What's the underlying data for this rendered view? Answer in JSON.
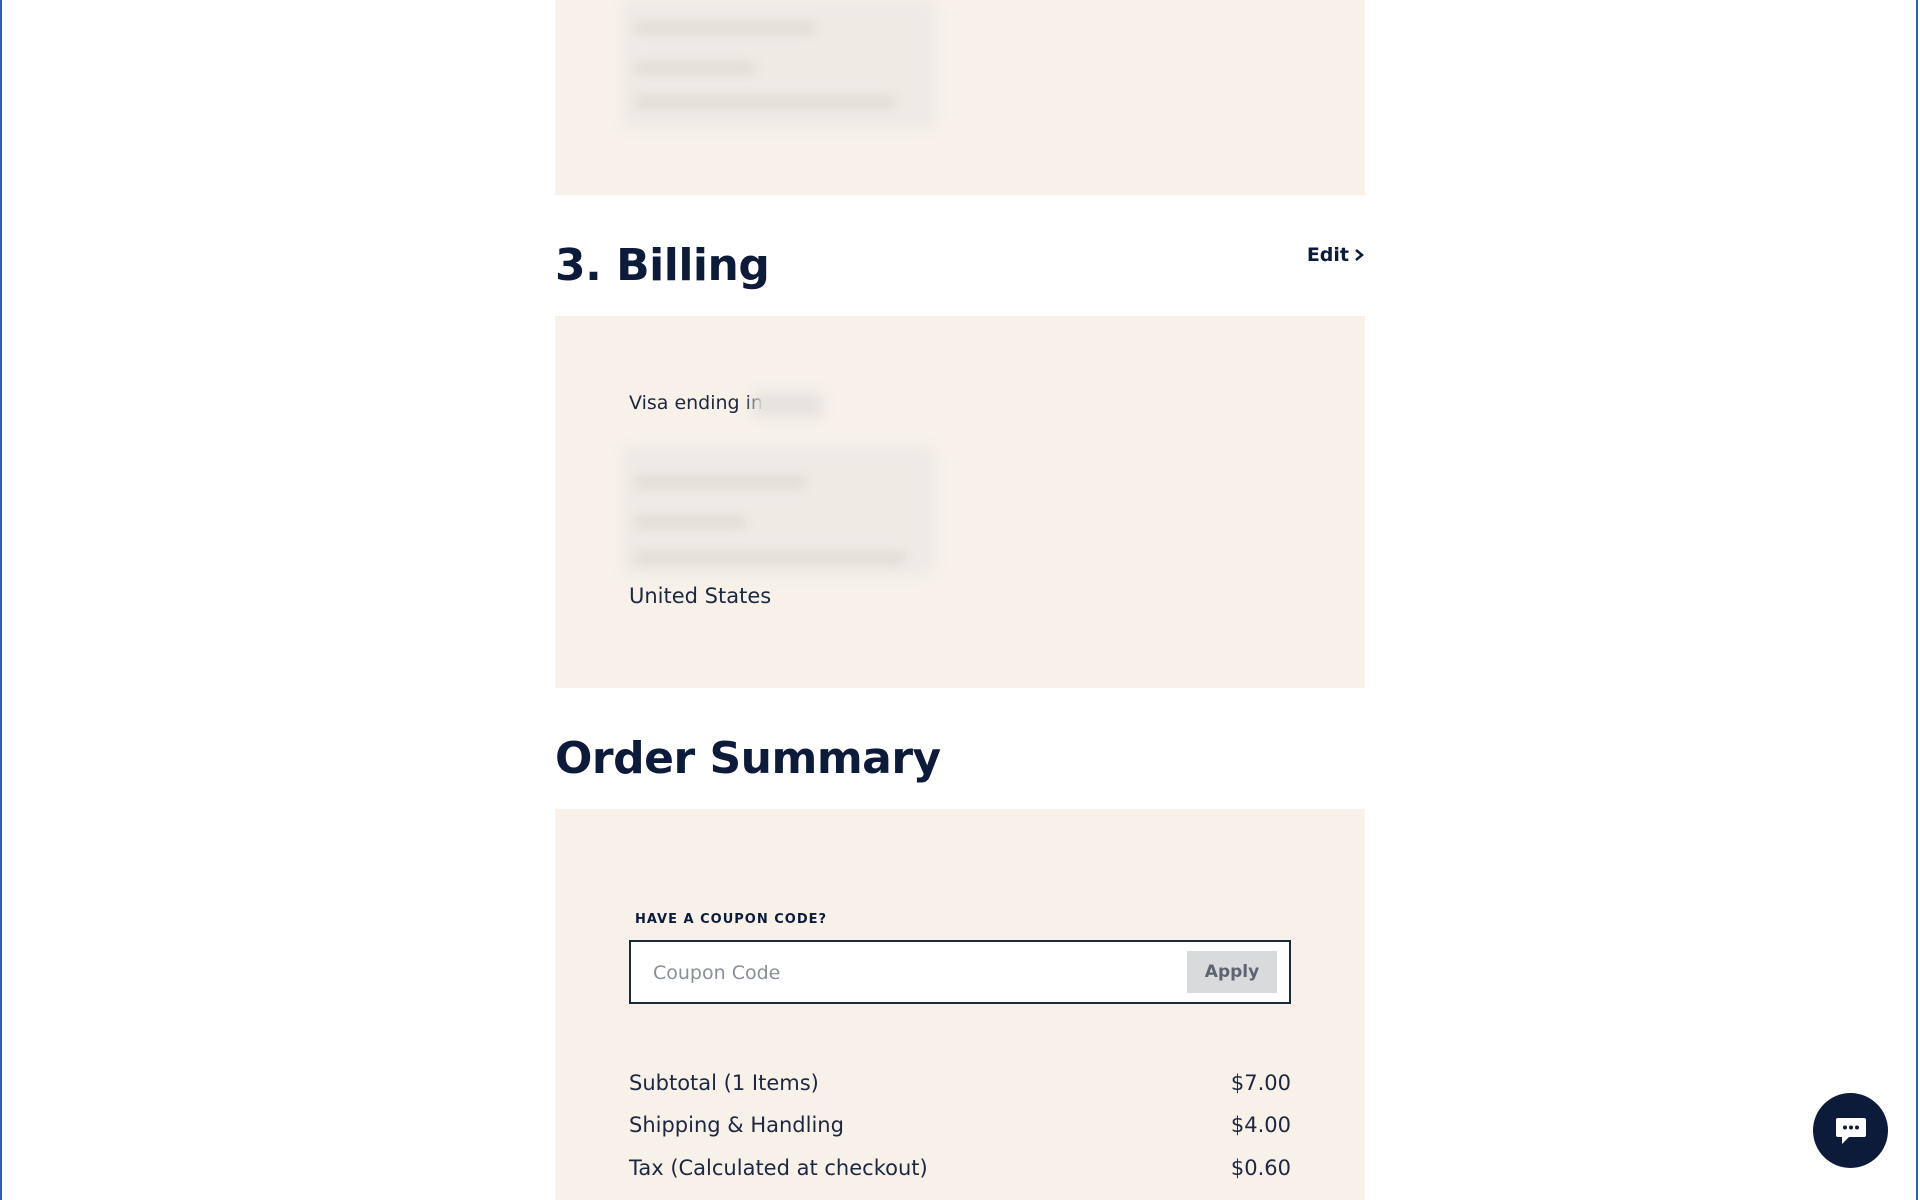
{
  "shipping_section": {
    "address_redacted": true
  },
  "billing": {
    "title": "3. Billing",
    "edit_label": "Edit",
    "card_text": "Visa ending in",
    "country": "United States"
  },
  "order_summary": {
    "title": "Order Summary",
    "coupon": {
      "label": "HAVE A COUPON CODE?",
      "placeholder": "Coupon Code",
      "apply_label": "Apply"
    },
    "rows": [
      {
        "label": "Subtotal (1 Items)",
        "value": "$7.00"
      },
      {
        "label": "Shipping & Handling",
        "value": "$4.00"
      },
      {
        "label": "Tax (Calculated at checkout)",
        "value": "$0.60"
      }
    ]
  },
  "icons": {
    "edit_chevron": "chevron-right-icon",
    "chat": "chat-bubble-icon"
  },
  "colors": {
    "navy": "#0d1b3a",
    "panel": "#f7f1ea"
  }
}
